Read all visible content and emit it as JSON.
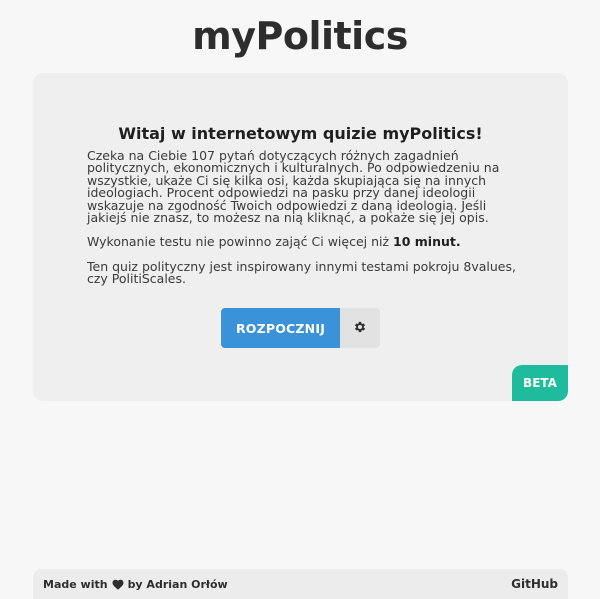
{
  "header": {
    "title": "myPolitics"
  },
  "intro": {
    "heading": "Witaj w internetowym quizie myPolitics!",
    "paragraph1": "Czeka na Ciebie 107 pytań dotyczących różnych zagadnień politycznych, ekonomicznych i kulturalnych. Po odpowiedzeniu na wszystkie, ukaże Ci się kilka osi, każda skupiająca się na innych ideologiach. Procent odpowiedzi na pasku przy danej ideologii wskazuje na zgodność Twoich odpowiedzi z daną ideologią. Jeśli jakiejś nie znasz, to możesz na nią kliknąć, a pokaże się jej opis.",
    "paragraph2_prefix": "Wykonanie testu nie powinno zająć Ci więcej niż ",
    "paragraph2_bold": "10 minut.",
    "paragraph3": "Ten quiz polityczny jest inspirowany innymi testami pokroju 8values, czy PolitiScales."
  },
  "actions": {
    "start_label": "ROZPOCZNIJ",
    "settings_icon": "gear-icon"
  },
  "badge": {
    "label": "BETA",
    "color": "#1ebc9c"
  },
  "footer": {
    "made_with": "Made with",
    "heart_icon": "heart-icon",
    "by_author": "by Adrian Orłów",
    "github_label": "GitHub"
  },
  "colors": {
    "background": "#f7f7f7",
    "card": "#efefef",
    "primary_button": "#3a93d9",
    "beta": "#1ebc9c"
  }
}
